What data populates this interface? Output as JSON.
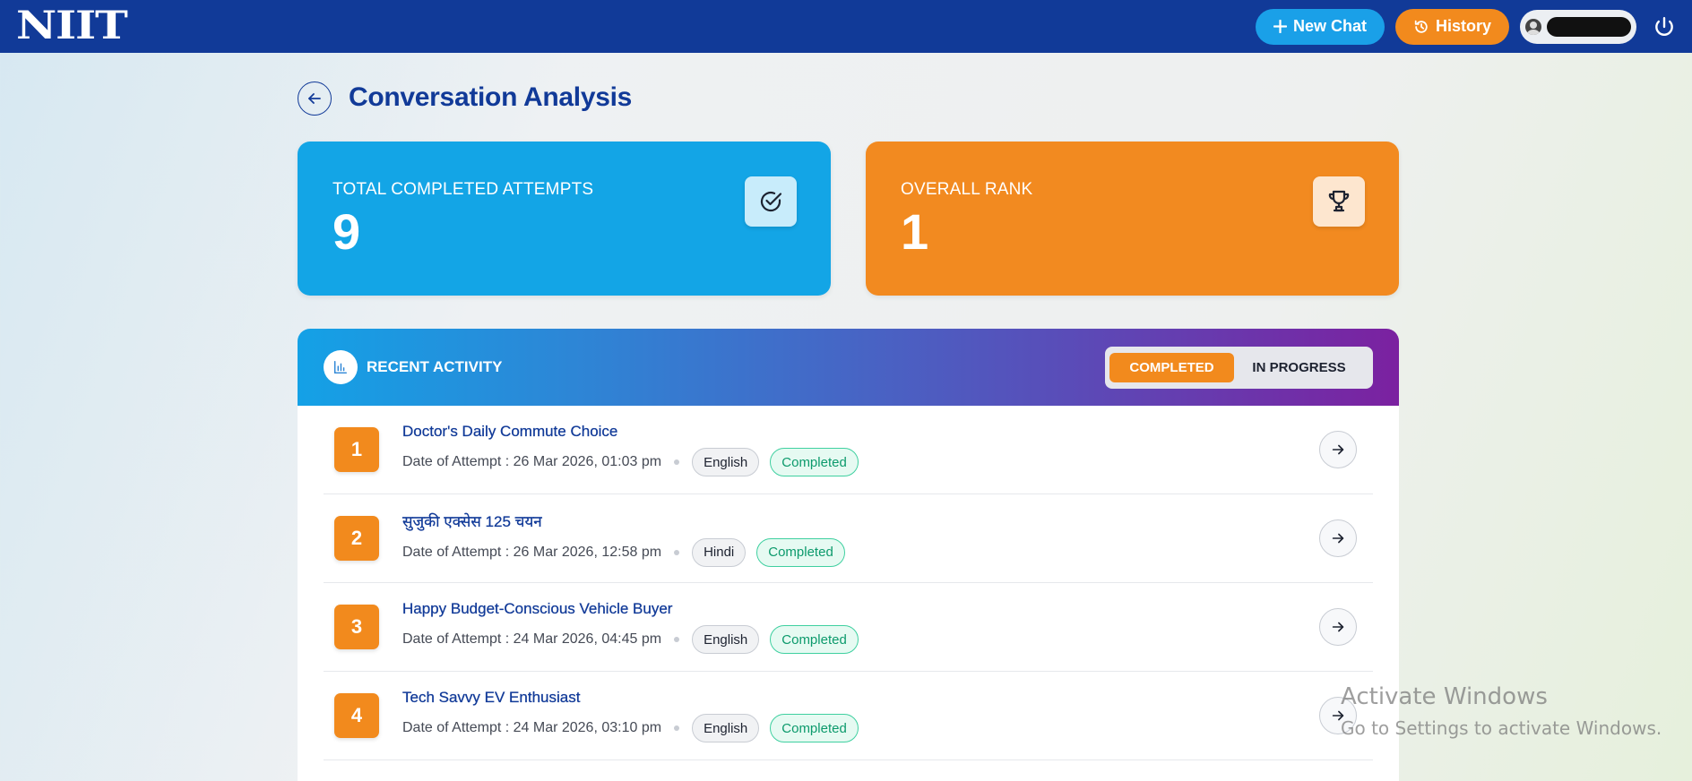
{
  "brand": {
    "logo": "NIIT"
  },
  "topbar": {
    "new_chat_label": "New Chat",
    "history_label": "History",
    "icons": {
      "new_chat": "plus-icon",
      "history": "history-icon",
      "user": "user-icon",
      "power": "power-icon"
    }
  },
  "header": {
    "title": "Conversation Analysis"
  },
  "stats": {
    "completed": {
      "label": "TOTAL COMPLETED ATTEMPTS",
      "value": "9",
      "icon": "check-circle-icon"
    },
    "rank": {
      "label": "OVERALL RANK",
      "value": "1",
      "icon": "trophy-icon"
    }
  },
  "activity": {
    "title": "RECENT ACTIVITY",
    "tabs": {
      "completed": "COMPLETED",
      "in_progress": "IN PROGRESS",
      "selected": "completed"
    },
    "items": [
      {
        "rank": "1",
        "title": "Doctor's Daily Commute Choice",
        "date": "Date of Attempt : 26 Mar 2026, 01:03 pm",
        "language": "English",
        "status": "Completed"
      },
      {
        "rank": "2",
        "title": "सुजुकी एक्सेस 125 चयन",
        "date": "Date of Attempt : 26 Mar 2026, 12:58 pm",
        "language": "Hindi",
        "status": "Completed"
      },
      {
        "rank": "3",
        "title": "Happy Budget-Conscious Vehicle Buyer",
        "date": "Date of Attempt : 24 Mar 2026, 04:45 pm",
        "language": "English",
        "status": "Completed"
      },
      {
        "rank": "4",
        "title": "Tech Savvy EV Enthusiast",
        "date": "Date of Attempt : 24 Mar 2026, 03:10 pm",
        "language": "English",
        "status": "Completed"
      }
    ]
  },
  "watermark": {
    "line1": "Activate Windows",
    "line2": "Go to Settings to activate Windows."
  },
  "colors": {
    "navy": "#113a98",
    "blue": "#13a5e6",
    "orange": "#f28a20",
    "purple": "#7b21a0",
    "green": "#0c9a6c"
  }
}
